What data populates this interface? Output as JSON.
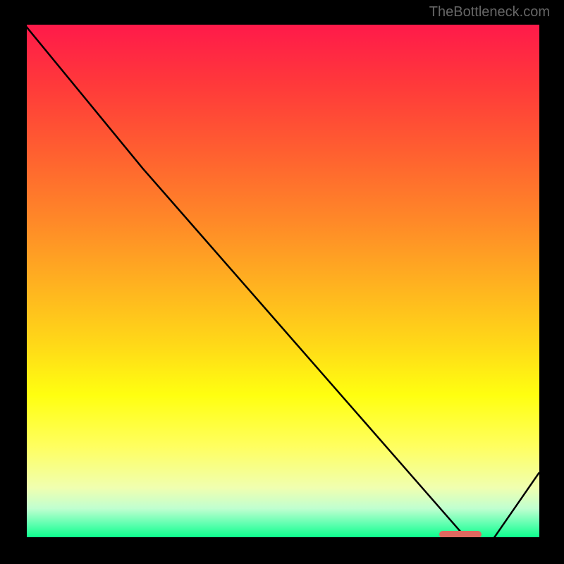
{
  "attribution": "TheBottleneck.com",
  "chart_data": {
    "type": "line",
    "title": "",
    "xlabel": "",
    "ylabel": "",
    "x_range": [
      0,
      100
    ],
    "y_range": [
      0,
      100
    ],
    "series": [
      {
        "name": "curve",
        "x": [
          0,
          23,
          86,
          91,
          100
        ],
        "y": [
          100,
          72,
          0,
          0,
          13
        ]
      }
    ],
    "marker": {
      "x_start": 82,
      "x_end": 90,
      "y": 0
    },
    "background": "red-yellow-green vertical gradient"
  }
}
